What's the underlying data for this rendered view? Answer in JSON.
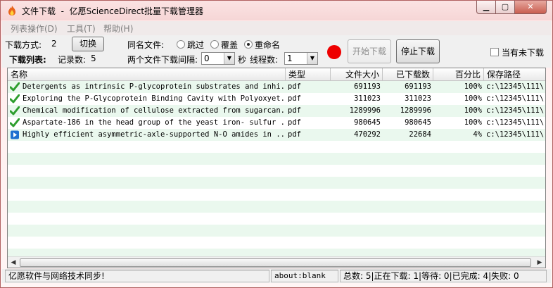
{
  "window": {
    "title": "文件下载  -  亿愿ScienceDirect批量下载管理器",
    "app_icon": "flame-icon"
  },
  "titlebar": {
    "minimize": "▁",
    "maximize": "▢",
    "close": "✕"
  },
  "menu": {
    "items": [
      "列表操作(D)",
      "工具(T)",
      "帮助(H)"
    ]
  },
  "toolbar": {
    "download_mode_label": "下载方式:",
    "download_mode_value": "2",
    "switch_button": "切换",
    "list_label": "下载列表:",
    "record_count_label": "记录数:",
    "record_count": "5",
    "same_name_label": "同名文件:",
    "radio_skip": "跳过",
    "radio_overwrite": "覆盖",
    "radio_rename": "重命名",
    "radio_selected": "rename",
    "interval_label": "两个文件下载间隔:",
    "interval_value": "0",
    "seconds_label": "秒",
    "threads_label": "线程数:",
    "threads_value": "1",
    "start_button": "开始下载",
    "stop_button": "停止下载",
    "pending_checkbox_label": "当有未下载",
    "indicator_color": "#ee0000"
  },
  "table": {
    "columns": [
      "名称",
      "类型",
      "文件大小",
      "已下载数",
      "百分比",
      "保存路径"
    ],
    "rows": [
      {
        "status": "check-icon",
        "name": "Detergents as intrinsic P-glycoprotein substrates and inhi...",
        "type": "pdf",
        "size": "691193",
        "downloaded": "691193",
        "percent": "100%",
        "path": "c:\\12345\\111\\"
      },
      {
        "status": "check-icon",
        "name": "Exploring the P-Glycoprotein Binding Cavity with Polyoxyet...",
        "type": "pdf",
        "size": "311023",
        "downloaded": "311023",
        "percent": "100%",
        "path": "c:\\12345\\111\\"
      },
      {
        "status": "check-icon",
        "name": "Chemical modification of cellulose extracted from sugarcan...",
        "type": "pdf",
        "size": "1289996",
        "downloaded": "1289996",
        "percent": "100%",
        "path": "c:\\12345\\111\\"
      },
      {
        "status": "check-icon",
        "name": "Aspartate-186 in the head group of the yeast iron- sulfur ...",
        "type": "pdf",
        "size": "980645",
        "downloaded": "980645",
        "percent": "100%",
        "path": "c:\\12345\\111\\"
      },
      {
        "status": "play-icon",
        "name": "Highly efficient asymmetric-axle-supported N-O amides in ...",
        "type": "pdf",
        "size": "470292",
        "downloaded": "22684",
        "percent": "4%",
        "path": "c:\\12345\\111\\"
      }
    ]
  },
  "statusbar": {
    "message": "亿愿软件与网络技术同步!",
    "url": "about:blank",
    "summary": "总数: 5|正在下载: 1|等待: 0|已完成: 4|失败: 0"
  },
  "colors": {
    "row_even": "#eaf8ee",
    "check_green": "#2e9e2e",
    "play_blue": "#1e6fd0"
  }
}
